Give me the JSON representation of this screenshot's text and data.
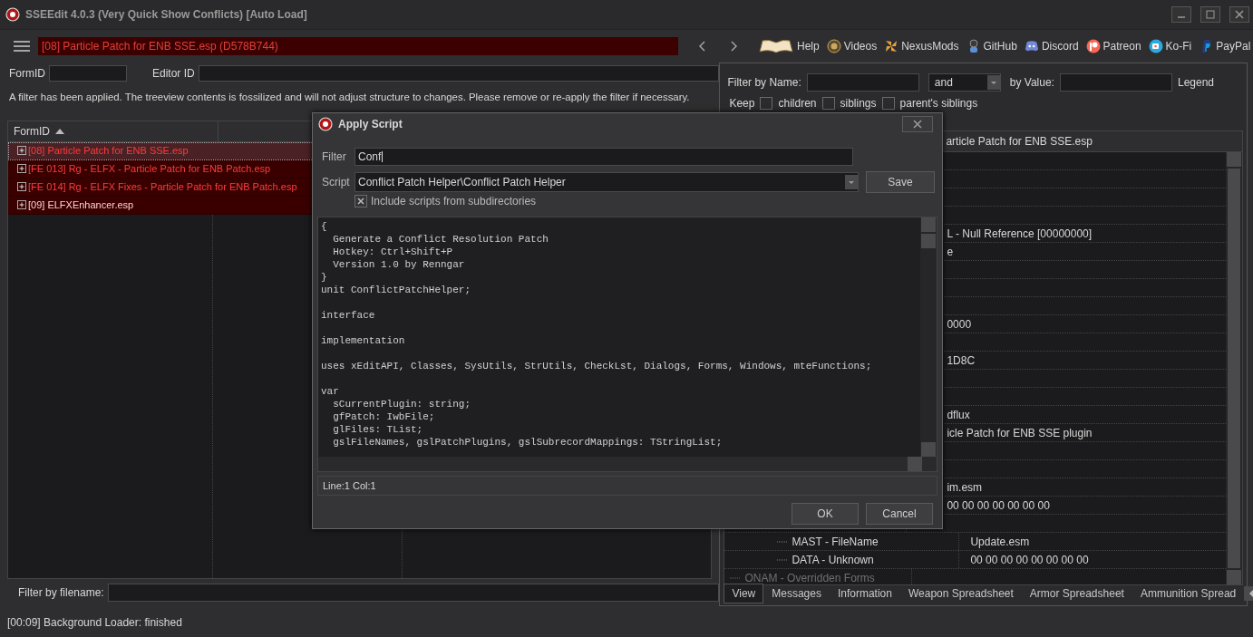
{
  "window": {
    "title": "SSEEdit 4.0.3 (Very Quick Show Conflicts) [Auto Load]"
  },
  "toolbar": {
    "current_file": "[08] Particle Patch for ENB SSE.esp (D578B744)",
    "links": [
      {
        "label": "Help",
        "kind": "book"
      },
      {
        "label": "Videos",
        "kind": "gp"
      },
      {
        "label": "NexusMods",
        "kind": "nexus"
      },
      {
        "label": "GitHub",
        "kind": "github"
      },
      {
        "label": "Discord",
        "kind": "discord"
      },
      {
        "label": "Patreon",
        "kind": "patreon"
      },
      {
        "label": "Ko-Fi",
        "kind": "kofi"
      },
      {
        "label": "PayPal",
        "kind": "paypal"
      }
    ]
  },
  "left_panel": {
    "formid_label": "FormID",
    "editor_id_label": "Editor ID",
    "notice": "A filter has been applied. The treeview contents is fossilized and will not adjust structure to changes.  Please remove or re-apply the filter if necessary.",
    "tree": {
      "column": "FormID",
      "rows": [
        {
          "label": "[08] Particle Patch for ENB SSE.esp",
          "selected": true,
          "kind": "conflict"
        },
        {
          "label": "[FE 013] Rg - ELFX - Particle Patch for ENB Patch.esp",
          "selected": false,
          "kind": "conflict"
        },
        {
          "label": "[FE 014] Rg - ELFX Fixes - Particle Patch for ENB Patch.esp",
          "selected": false,
          "kind": "conflict"
        },
        {
          "label": "[09] ELFXEnhancer.esp",
          "selected": false,
          "kind": "master"
        }
      ]
    },
    "filter_label": "Filter by filename:"
  },
  "right_panel": {
    "filter_name_label": "Filter by Name:",
    "operator": "and",
    "value_label": "by Value:",
    "legend": "Legend",
    "keep_label": "Keep",
    "keep_options": [
      {
        "label": "children",
        "checked": false
      },
      {
        "label": "siblings",
        "checked": false
      },
      {
        "label": "parent's siblings",
        "checked": false
      }
    ],
    "record_header": "article Patch for ENB SSE.esp",
    "record_rows": [
      {},
      {},
      {},
      {},
      {
        "kind": "value",
        "value": "L - Null Reference [00000000]"
      },
      {
        "kind": "value",
        "value": "e"
      },
      {},
      {},
      {},
      {
        "kind": "value",
        "value": "0000"
      },
      {},
      {
        "kind": "value",
        "value": "1D8C"
      },
      {},
      {},
      {
        "kind": "value",
        "value": "dflux"
      },
      {
        "kind": "value",
        "value": "icle Patch for ENB SSE plugin"
      },
      {},
      {},
      {
        "kind": "value",
        "value": "im.esm"
      },
      {
        "kind": "value",
        "value": "00 00 00 00 00 00 00"
      },
      {},
      {
        "kind": "subrecord",
        "name": "MAST - FileName",
        "value": "Update.esm"
      },
      {
        "kind": "subrecord",
        "name": "DATA - Unknown",
        "value": "00 00 00 00 00 00 00 00"
      },
      {
        "kind": "overridden",
        "name": "ONAM - Overridden Forms"
      }
    ],
    "tabs": [
      {
        "label": "View",
        "selected": true
      },
      {
        "label": "Messages",
        "selected": false
      },
      {
        "label": "Information",
        "selected": false
      },
      {
        "label": "Weapon Spreadsheet",
        "selected": false
      },
      {
        "label": "Armor Spreadsheet",
        "selected": false
      },
      {
        "label": "Ammunition Spread",
        "selected": false
      }
    ]
  },
  "dialog": {
    "title": "Apply Script",
    "filter_label": "Filter",
    "filter_value": "Conf",
    "script_label": "Script",
    "script_value": "Conflict Patch Helper\\Conflict Patch Helper",
    "save": "Save",
    "include_subdirs": {
      "label": "Include scripts from subdirectories",
      "checked": true
    },
    "code": "{\n  Generate a Conflict Resolution Patch\n  Hotkey: Ctrl+Shift+P\n  Version 1.0 by Renngar\n}\nunit ConflictPatchHelper;\n\ninterface\n\nimplementation\n\nuses xEditAPI, Classes, SysUtils, StrUtils, CheckLst, Dialogs, Forms, Windows, mteFunctions;\n\nvar\n  sCurrentPlugin: string;\n  gfPatch: IwbFile;\n  glFiles: TList;\n  gslFileNames, gslPatchPlugins, gslSubrecordMappings: TStringList;",
    "position": "Line:1 Col:1",
    "buttons": [
      "OK",
      "Cancel"
    ]
  },
  "status_bar": "[00:09] Background Loader: finished"
}
